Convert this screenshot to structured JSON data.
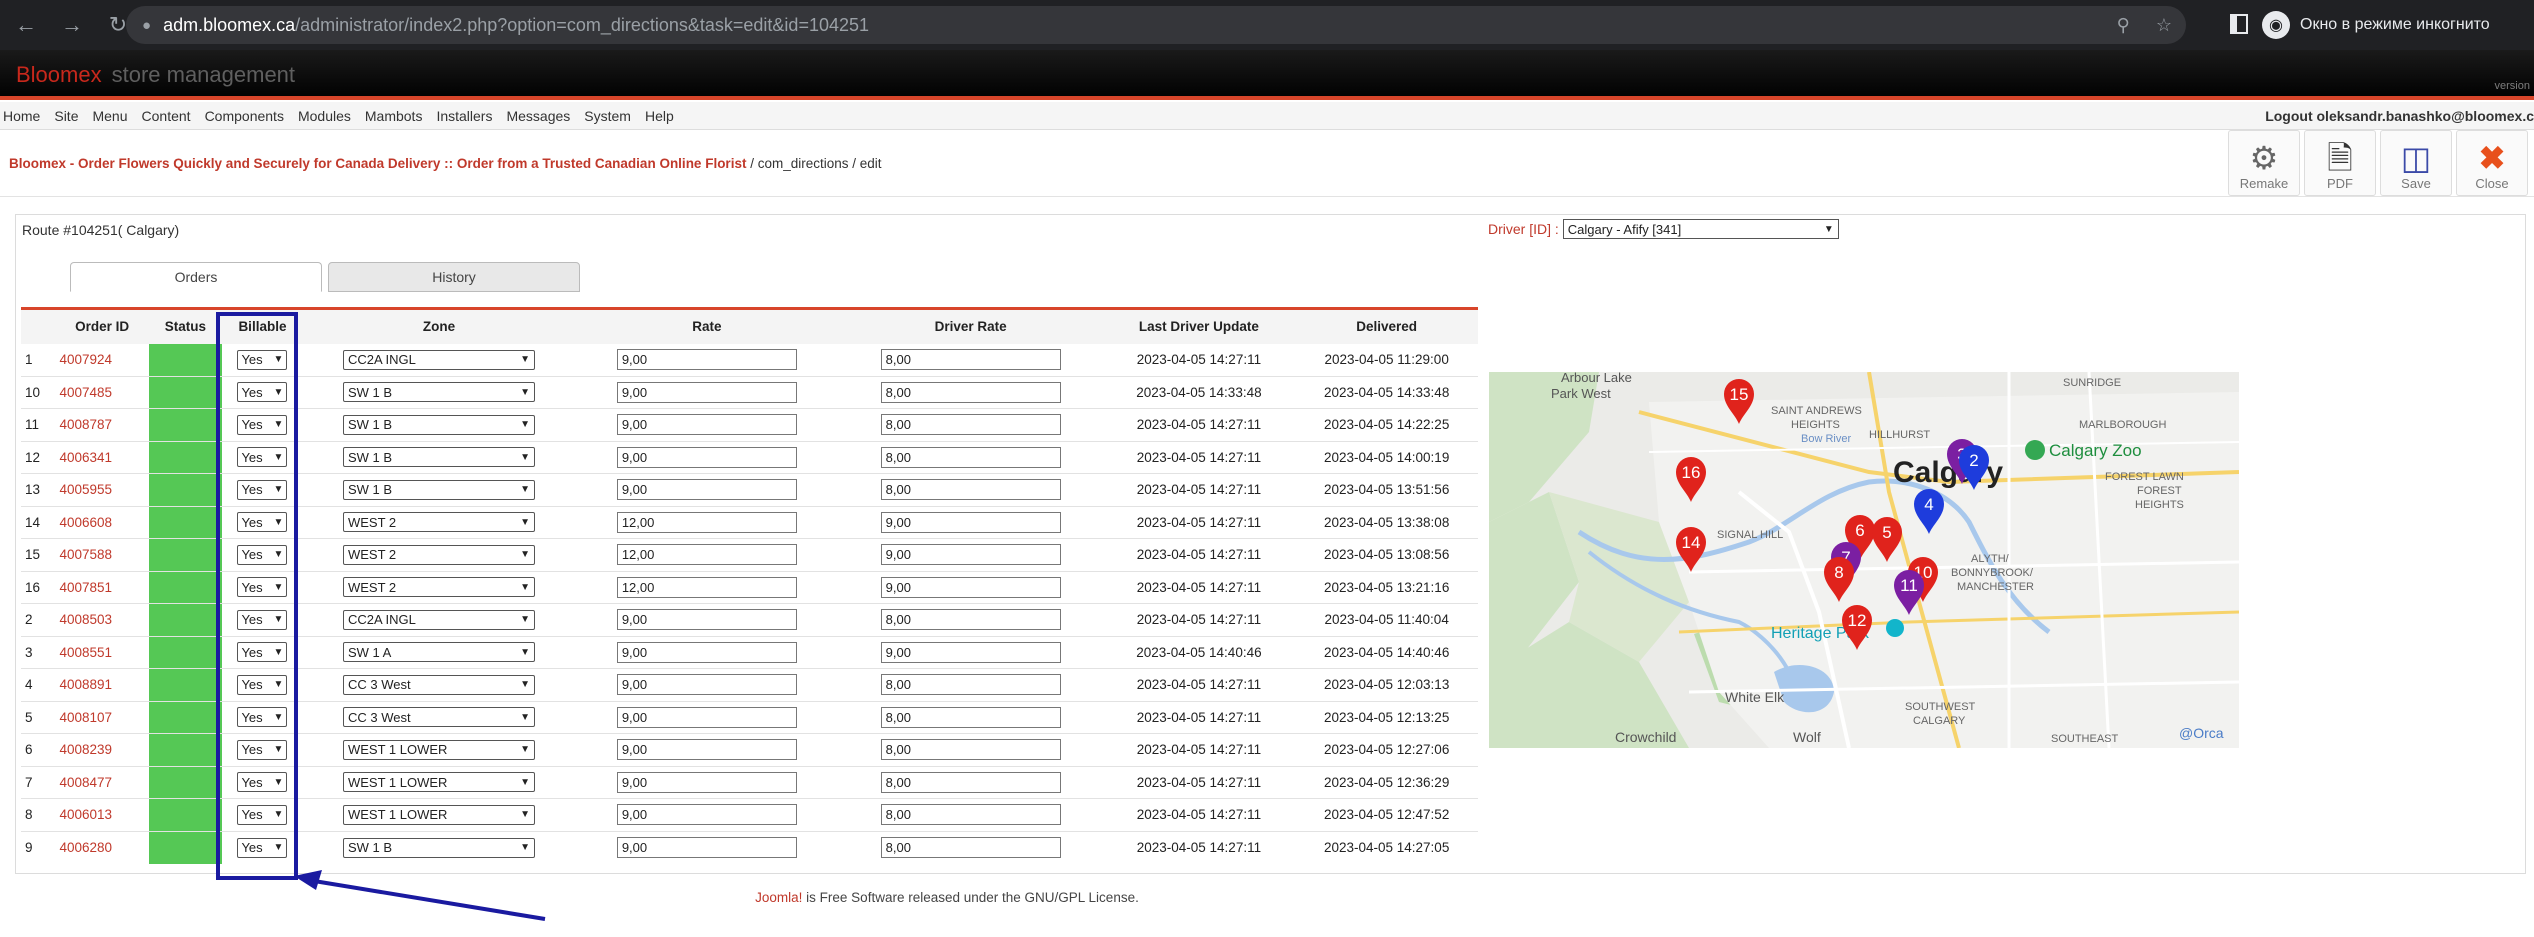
{
  "browser": {
    "url_host": "adm.bloomex.ca",
    "url_path": "/administrator/index2.php?option=com_directions&task=edit&id=104251",
    "incognito_label": "Окно в режиме инкогнито"
  },
  "header": {
    "brand_red": "Bloomex",
    "brand_grey": "store management",
    "version": "version"
  },
  "menu": {
    "items": [
      "Home",
      "Site",
      "Menu",
      "Content",
      "Components",
      "Modules",
      "Mambots",
      "Installers",
      "Messages",
      "System",
      "Help"
    ],
    "logout": "Logout oleksandr.banashko@bloomex.c"
  },
  "breadcrumb": {
    "link": "Bloomex - Order Flowers Quickly and Securely for Canada Delivery :: Order from a Trusted Canadian Online Florist",
    "rest": " / com_directions / edit"
  },
  "toolbar": {
    "remake": "Remake",
    "pdf": "PDF",
    "save": "Save",
    "close": "Close"
  },
  "route": {
    "title": "Route #104251( Calgary)",
    "driver_label": "Driver [ID] :",
    "driver_value": "Calgary - Afify [341]"
  },
  "tabs": {
    "orders": "Orders",
    "history": "History"
  },
  "table": {
    "headers": {
      "order_id": "Order ID",
      "status": "Status",
      "billable": "Billable",
      "zone": "Zone",
      "rate": "Rate",
      "driver_rate": "Driver Rate",
      "last_update": "Last Driver Update",
      "delivered": "Delivered"
    },
    "rows": [
      {
        "n": "1",
        "id": "4007924",
        "billable": "Yes",
        "zone": "CC2A INGL",
        "rate": "9,00",
        "driver_rate": "8,00",
        "updated": "2023-04-05 14:27:11",
        "delivered": "2023-04-05 11:29:00"
      },
      {
        "n": "10",
        "id": "4007485",
        "billable": "Yes",
        "zone": "SW 1 B",
        "rate": "9,00",
        "driver_rate": "8,00",
        "updated": "2023-04-05 14:33:48",
        "delivered": "2023-04-05 14:33:48"
      },
      {
        "n": "11",
        "id": "4008787",
        "billable": "Yes",
        "zone": "SW 1 B",
        "rate": "9,00",
        "driver_rate": "8,00",
        "updated": "2023-04-05 14:27:11",
        "delivered": "2023-04-05 14:22:25"
      },
      {
        "n": "12",
        "id": "4006341",
        "billable": "Yes",
        "zone": "SW 1 B",
        "rate": "9,00",
        "driver_rate": "8,00",
        "updated": "2023-04-05 14:27:11",
        "delivered": "2023-04-05 14:00:19"
      },
      {
        "n": "13",
        "id": "4005955",
        "billable": "Yes",
        "zone": "SW 1 B",
        "rate": "9,00",
        "driver_rate": "8,00",
        "updated": "2023-04-05 14:27:11",
        "delivered": "2023-04-05 13:51:56"
      },
      {
        "n": "14",
        "id": "4006608",
        "billable": "Yes",
        "zone": "WEST 2",
        "rate": "12,00",
        "driver_rate": "9,00",
        "updated": "2023-04-05 14:27:11",
        "delivered": "2023-04-05 13:38:08"
      },
      {
        "n": "15",
        "id": "4007588",
        "billable": "Yes",
        "zone": "WEST 2",
        "rate": "12,00",
        "driver_rate": "9,00",
        "updated": "2023-04-05 14:27:11",
        "delivered": "2023-04-05 13:08:56"
      },
      {
        "n": "16",
        "id": "4007851",
        "billable": "Yes",
        "zone": "WEST 2",
        "rate": "12,00",
        "driver_rate": "9,00",
        "updated": "2023-04-05 14:27:11",
        "delivered": "2023-04-05 13:21:16"
      },
      {
        "n": "2",
        "id": "4008503",
        "billable": "Yes",
        "zone": "CC2A INGL",
        "rate": "9,00",
        "driver_rate": "8,00",
        "updated": "2023-04-05 14:27:11",
        "delivered": "2023-04-05 11:40:04"
      },
      {
        "n": "3",
        "id": "4008551",
        "billable": "Yes",
        "zone": "SW 1 A",
        "rate": "9,00",
        "driver_rate": "9,00",
        "updated": "2023-04-05 14:40:46",
        "delivered": "2023-04-05 14:40:46"
      },
      {
        "n": "4",
        "id": "4008891",
        "billable": "Yes",
        "zone": "CC 3 West",
        "rate": "9,00",
        "driver_rate": "8,00",
        "updated": "2023-04-05 14:27:11",
        "delivered": "2023-04-05 12:03:13"
      },
      {
        "n": "5",
        "id": "4008107",
        "billable": "Yes",
        "zone": "CC 3 West",
        "rate": "9,00",
        "driver_rate": "8,00",
        "updated": "2023-04-05 14:27:11",
        "delivered": "2023-04-05 12:13:25"
      },
      {
        "n": "6",
        "id": "4008239",
        "billable": "Yes",
        "zone": "WEST 1 LOWER",
        "rate": "9,00",
        "driver_rate": "8,00",
        "updated": "2023-04-05 14:27:11",
        "delivered": "2023-04-05 12:27:06"
      },
      {
        "n": "7",
        "id": "4008477",
        "billable": "Yes",
        "zone": "WEST 1 LOWER",
        "rate": "9,00",
        "driver_rate": "8,00",
        "updated": "2023-04-05 14:27:11",
        "delivered": "2023-04-05 12:36:29"
      },
      {
        "n": "8",
        "id": "4006013",
        "billable": "Yes",
        "zone": "WEST 1 LOWER",
        "rate": "9,00",
        "driver_rate": "8,00",
        "updated": "2023-04-05 14:27:11",
        "delivered": "2023-04-05 12:47:52"
      },
      {
        "n": "9",
        "id": "4006280",
        "billable": "Yes",
        "zone": "SW 1 B",
        "rate": "9,00",
        "driver_rate": "8,00",
        "updated": "2023-04-05 14:27:11",
        "delivered": "2023-04-05 14:27:05"
      }
    ]
  },
  "map": {
    "labels": {
      "city": "Calgary",
      "zoo": "Calgary Zoo",
      "arbour": "Arbour Lake",
      "parkwest": "Park West",
      "sunridge": "SUNRIDGE",
      "saint_andrews": "SAINT ANDREWS",
      "heights": "HEIGHTS",
      "hillhurst": "HILLHURST",
      "marlborough": "MARLBOROUGH",
      "forest_lawn": "FOREST LAWN",
      "forest_heights": "FOREST",
      "forest_heights2": "HEIGHTS",
      "bow_river": "Bow River",
      "signal_hill": "SIGNAL HILL",
      "alyth": "ALYTH/",
      "bonnybrook": "BONNYBROOK/",
      "manchester": "MANCHESTER",
      "heritage_park": "Heritage Park",
      "white_elk": "White Elk",
      "southwest": "SOUTHWEST",
      "calgary_sw": "CALGARY",
      "crowchild": "Crowchild",
      "wolf": "Wolf",
      "southeast": "SOUTHEAST",
      "credit": "@Orca"
    },
    "markers": [
      {
        "label": "15",
        "color": "#e0231c"
      },
      {
        "label": "16",
        "color": "#e0231c"
      },
      {
        "label": "14",
        "color": "#e0231c"
      },
      {
        "label": "3",
        "color": "#7b1fa2"
      },
      {
        "label": "2",
        "color": "#1e3cdc"
      },
      {
        "label": "4",
        "color": "#1e3cdc"
      },
      {
        "label": "6",
        "color": "#e0231c"
      },
      {
        "label": "5",
        "color": "#e0231c"
      },
      {
        "label": "7",
        "color": "#7b1fa2"
      },
      {
        "label": "8",
        "color": "#e0231c"
      },
      {
        "label": "10",
        "color": "#e0231c"
      },
      {
        "label": "11",
        "color": "#7b1fa2"
      },
      {
        "label": "12",
        "color": "#e0231c"
      }
    ]
  },
  "footer": {
    "joomla": "Joomla!",
    "rest": " is Free Software released under the GNU/GPL License."
  },
  "colors": {
    "accent_red": "#c0392b",
    "status_green": "#55c855",
    "highlight_blue": "#1a1aa0"
  }
}
